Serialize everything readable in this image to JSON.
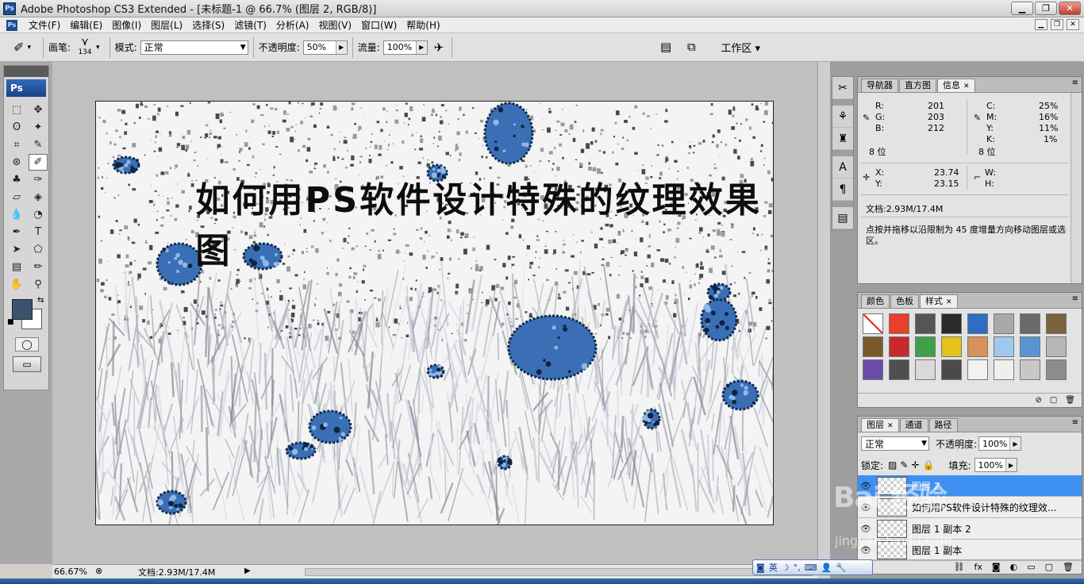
{
  "window": {
    "title": "Adobe Photoshop CS3 Extended - [未标题-1 @ 66.7% (图层 2, RGB/8)]",
    "logo": "Ps"
  },
  "menu": [
    "文件(F)",
    "编辑(E)",
    "图像(I)",
    "图层(L)",
    "选择(S)",
    "滤镜(T)",
    "分析(A)",
    "视图(V)",
    "窗口(W)",
    "帮助(H)"
  ],
  "options": {
    "brush_label": "画笔:",
    "brush_size": "134",
    "mode_label": "模式:",
    "mode_value": "正常",
    "opacity_label": "不透明度:",
    "opacity_value": "50%",
    "flow_label": "流量:",
    "flow_value": "100%",
    "workspace_label": "工作区 ▾"
  },
  "toolbox": {
    "logo": "Ps",
    "tools": [
      {
        "name": "marquee-tool-icon",
        "glyph": "⬚"
      },
      {
        "name": "move-tool-icon",
        "glyph": "✥"
      },
      {
        "name": "lasso-tool-icon",
        "glyph": "ʘ"
      },
      {
        "name": "magic-wand-tool-icon",
        "glyph": "✦"
      },
      {
        "name": "crop-tool-icon",
        "glyph": "⌗"
      },
      {
        "name": "eyedropper-slice-tool-icon",
        "glyph": "✎"
      },
      {
        "name": "healing-brush-tool-icon",
        "glyph": "⊛"
      },
      {
        "name": "brush-tool-icon",
        "glyph": "✐"
      },
      {
        "name": "clone-stamp-tool-icon",
        "glyph": "♣"
      },
      {
        "name": "history-brush-tool-icon",
        "glyph": "✑"
      },
      {
        "name": "eraser-tool-icon",
        "glyph": "▱"
      },
      {
        "name": "paint-bucket-tool-icon",
        "glyph": "◈"
      },
      {
        "name": "blur-tool-icon",
        "glyph": "💧"
      },
      {
        "name": "dodge-tool-icon",
        "glyph": "◔"
      },
      {
        "name": "pen-tool-icon",
        "glyph": "✒"
      },
      {
        "name": "type-tool-icon",
        "glyph": "T"
      },
      {
        "name": "path-selection-tool-icon",
        "glyph": "➤"
      },
      {
        "name": "shape-tool-icon",
        "glyph": "⬠"
      },
      {
        "name": "notes-tool-icon",
        "glyph": "▤"
      },
      {
        "name": "eyedropper-tool-icon",
        "glyph": "✏"
      },
      {
        "name": "hand-tool-icon",
        "glyph": "✋"
      },
      {
        "name": "zoom-tool-icon",
        "glyph": "⚲"
      }
    ],
    "foreground_color": "#3c5370",
    "background_color": "#ffffff"
  },
  "canvas": {
    "image_text": "如何用PS软件设计特殊的纹理效果图"
  },
  "status": {
    "zoom": "66.67%",
    "doc_info": "文档:2.93M/17.4M"
  },
  "info_panel": {
    "tabs": [
      "导航器",
      "直方图",
      "信息"
    ],
    "r_label": "R:",
    "r_value": "201",
    "g_label": "G:",
    "g_value": "203",
    "b_label": "B:",
    "b_value": "212",
    "rgb_bits": "8 位",
    "c_label": "C:",
    "c_value": "25%",
    "m_label": "M:",
    "m_value": "16%",
    "y_label": "Y:",
    "y_value": "11%",
    "k_label": "K:",
    "k_value": "1%",
    "cmyk_bits": "8 位",
    "x_label": "X:",
    "x_value": "23.74",
    "yy_label": "Y:",
    "yy_value": "23.15",
    "w_label": "W:",
    "h_label": "H:",
    "doc_info": "文档:2.93M/17.4M",
    "hint": "点按并拖移以沿限制为 45 度增量方向移动图层或选区。"
  },
  "styles_panel": {
    "tabs": [
      "颜色",
      "色板",
      "样式"
    ],
    "swatches": [
      "#ffffff",
      "#e8402a",
      "#555555",
      "#2a2a2a",
      "#2f6cc4",
      "#a9a9a9",
      "#6a6a6a",
      "#7a6140",
      "#7a5a2a",
      "#c82a2a",
      "#3fa04a",
      "#e3c21a",
      "#d7915a",
      "#9ec9ef",
      "#5a94d4",
      "#b7b7b7",
      "#6a4ca8",
      "#4f4f4f",
      "#d9d9d9",
      "#4a4a4a",
      "#f2f2f2",
      "#efefef",
      "#c7c7c7",
      "#8c8c8c"
    ]
  },
  "layers_panel": {
    "tabs": [
      "图层",
      "通道",
      "路径"
    ],
    "blend_mode": "正常",
    "opacity_label": "不透明度:",
    "opacity_value": "100%",
    "lock_label": "锁定:",
    "fill_label": "填充:",
    "fill_value": "100%",
    "layers": [
      {
        "name": "图层 2",
        "selected": true
      },
      {
        "name": "如何用PS软件设计特殊的纹理效...",
        "selected": false
      },
      {
        "name": "图层 1 副本 2",
        "selected": false
      },
      {
        "name": "图层 1 副本",
        "selected": false
      }
    ]
  },
  "ime": {
    "label": "英"
  },
  "watermark": {
    "text": "Bai 经验",
    "sub": "jingyan.baidu.com"
  }
}
